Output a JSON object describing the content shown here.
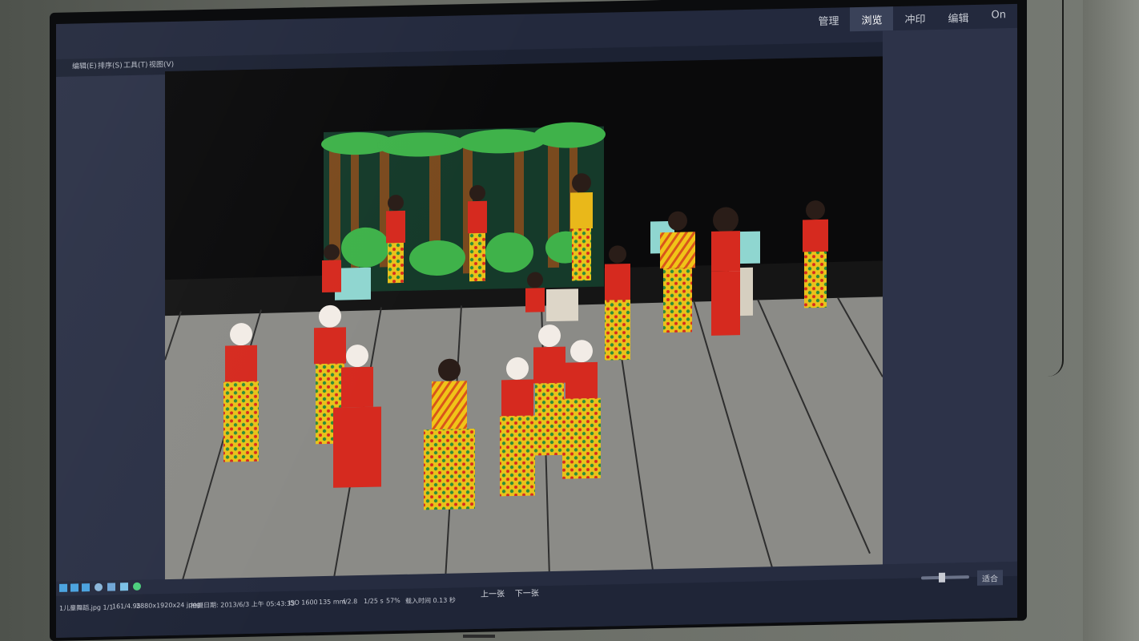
{
  "modules": [
    {
      "label": "管理",
      "active": false
    },
    {
      "label": "浏览",
      "active": true
    },
    {
      "label": "冲印",
      "active": false
    },
    {
      "label": "编辑",
      "active": false
    },
    {
      "label": "On",
      "active": false
    }
  ],
  "menu": [
    "编辑(E)",
    "排序(S)",
    "工具(T)",
    "视图(V)"
  ],
  "info_bar": {
    "file": "1儿童舞蹈.jpg 1/1",
    "folder": "161/4.95",
    "dimensions": "2880x1920x24 jpeg",
    "date": "拍摄日期: 2013/6/3 上午 05:43:33",
    "iso": "ISO 1600",
    "focal": "135 mm",
    "aperture": "f/2.8",
    "shutter": "1/25 s",
    "zoom": "57%",
    "load": "载入时间 0.13 秒"
  },
  "nav": {
    "prev": "上一张",
    "next": "下一张"
  },
  "fit_label": "适合",
  "colors": {
    "screen": "#23293d",
    "panel": "#2b3146",
    "stage_floor": "#8e8e8a",
    "costume_yellow": "#e9c21a",
    "costume_red": "#d62a1f",
    "forest_green": "#3fb24a"
  },
  "icons": [
    "grid-icon",
    "single-view-icon",
    "compare-icon",
    "flag-icon",
    "rotate-icon",
    "crop-icon",
    "color-icon"
  ]
}
